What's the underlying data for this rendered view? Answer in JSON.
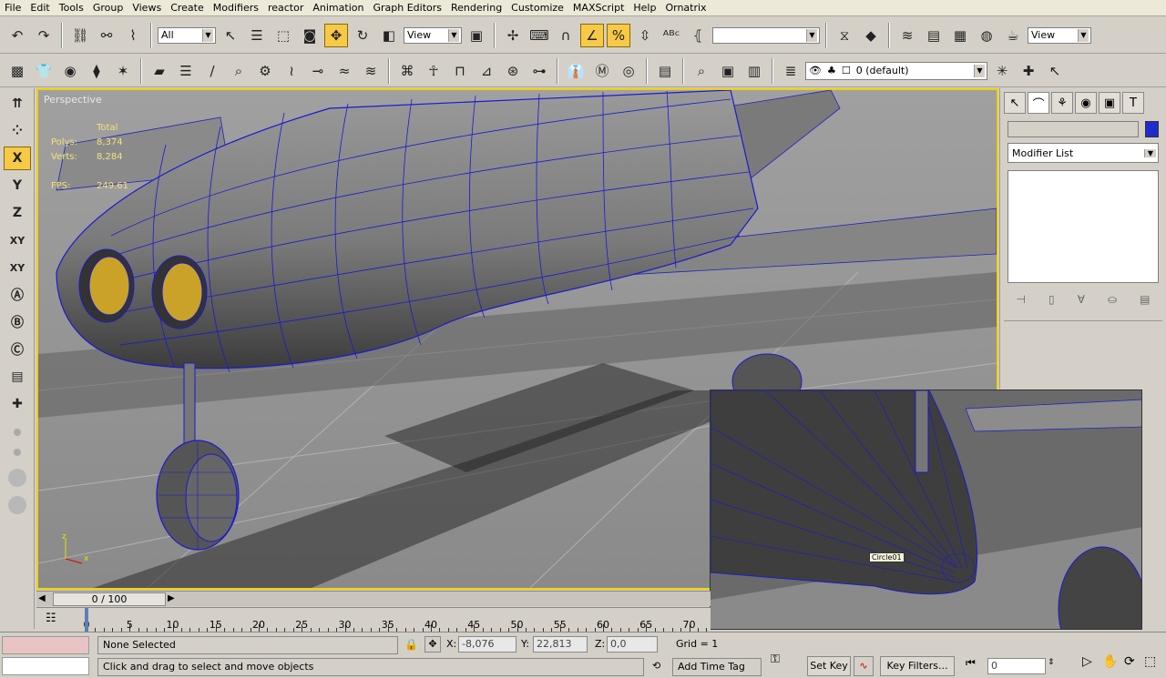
{
  "menu": [
    "File",
    "Edit",
    "Tools",
    "Group",
    "Views",
    "Create",
    "Modifiers",
    "reactor",
    "Animation",
    "Graph Editors",
    "Rendering",
    "Customize",
    "MAXScript",
    "Help",
    "Ornatrix"
  ],
  "toolbar": {
    "selection_filter": "All",
    "ref_coord": "View",
    "named_selection": "",
    "view_dropdown": "View"
  },
  "layer": {
    "name": "0 (default)"
  },
  "left_tools": [
    "X",
    "Y",
    "Z",
    "XY",
    "XY"
  ],
  "viewport": {
    "label": "Perspective",
    "stats_header": "Total",
    "polys_label": "Polys:",
    "polys_value": "8,374",
    "verts_label": "Verts:",
    "verts_value": "8,284",
    "fps_label": "FPS:",
    "fps_value": "249.61",
    "axis_z": "z",
    "axis_x": "x"
  },
  "inset": {
    "tag": "Circle01"
  },
  "command_panel": {
    "name_value": "",
    "object_color": "#1e2ccf",
    "modifier_list": "Modifier List"
  },
  "timeline": {
    "frame_display": "0 / 100",
    "ticks": [
      0,
      5,
      10,
      15,
      20,
      25,
      30,
      35,
      40,
      45,
      50,
      55,
      60,
      65,
      70
    ]
  },
  "status": {
    "selection": "None Selected",
    "prompt": "Click and drag to select and move objects",
    "x_label": "X:",
    "x_value": "-8,076",
    "y_label": "Y:",
    "y_value": "22,813",
    "z_label": "Z:",
    "z_value": "0,0",
    "grid": "Grid = 1",
    "add_time_tag": "Add Time Tag",
    "set_key": "Set Key",
    "key_filters": "Key Filters...",
    "current_frame": "0"
  },
  "colors": {
    "active_tool": "#f7c948",
    "viewport_border": "#f0d000",
    "wireframe": "#1a1ad0"
  }
}
